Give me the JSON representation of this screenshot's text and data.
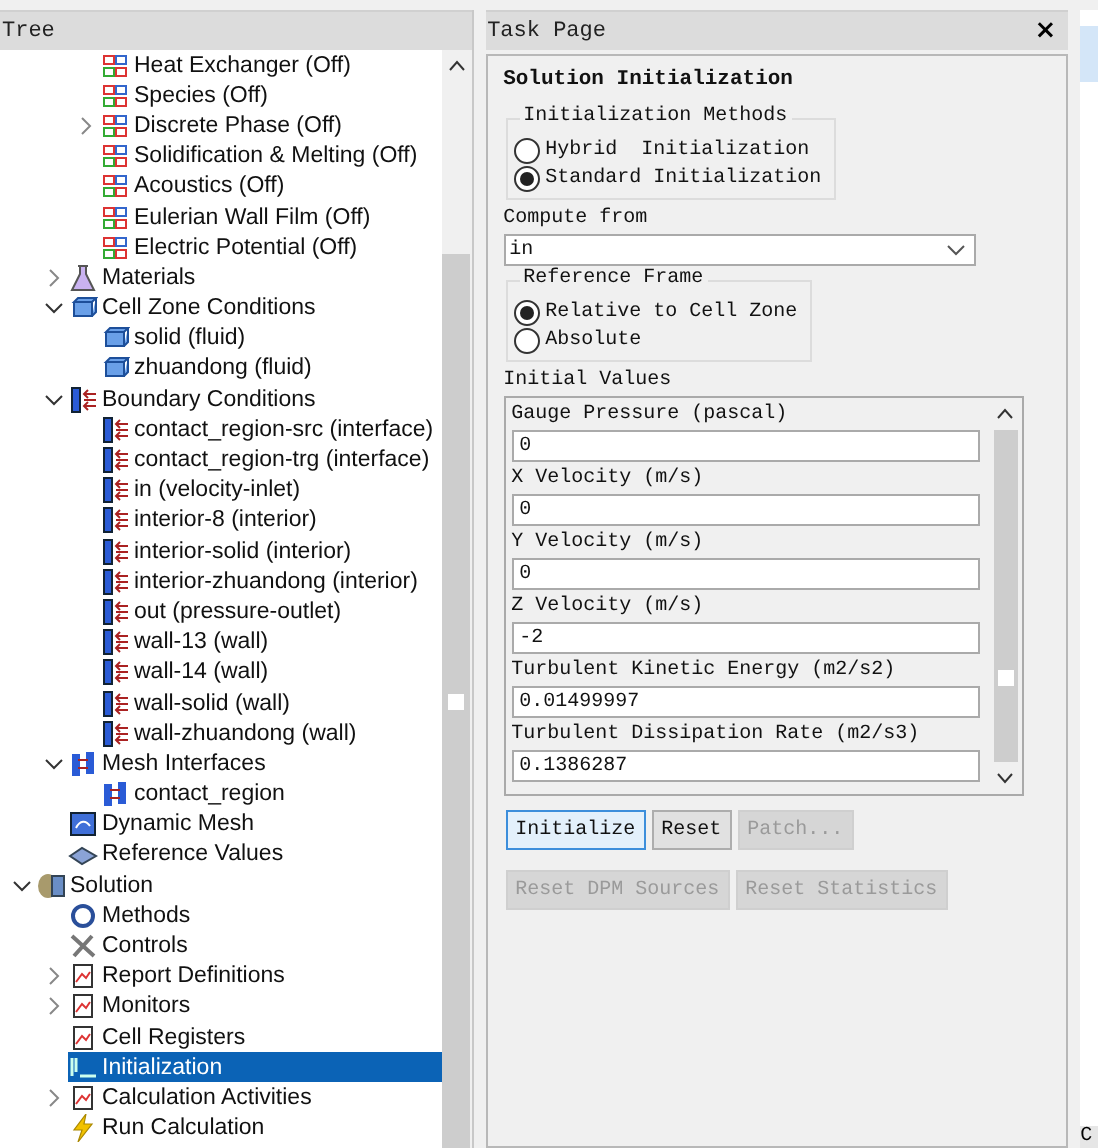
{
  "tree": {
    "title": "Tree",
    "items": [
      {
        "children": [
          {
            "children": [
              {
                "label": "Heat Exchanger (Off)",
                "kind": "model",
                "selected": false
              },
              {
                "label": "Species (Off)",
                "kind": "model",
                "selected": false
              },
              {
                "label": "Discrete Phase (Off)",
                "kind": "model",
                "expanded": false,
                "selected": false
              },
              {
                "label": "Solidification & Melting (Off)",
                "kind": "model",
                "selected": false
              },
              {
                "label": "Acoustics (Off)",
                "kind": "model",
                "selected": false
              },
              {
                "label": "Eulerian Wall Film (Off)",
                "kind": "model",
                "selected": false
              },
              {
                "label": "Electric Potential (Off)",
                "kind": "model",
                "selected": false
              }
            ]
          },
          {
            "label": "Materials",
            "kind": "flask",
            "expanded": false,
            "selected": false
          },
          {
            "label": "Cell Zone Conditions",
            "kind": "block",
            "expanded": true,
            "selected": false,
            "children": [
              {
                "label": "solid (fluid)",
                "kind": "block",
                "selected": false
              },
              {
                "label": "zhuandong (fluid)",
                "kind": "block",
                "selected": false
              }
            ]
          },
          {
            "label": "Boundary Conditions",
            "kind": "boundary",
            "expanded": true,
            "selected": false,
            "children": [
              {
                "label": "contact_region-src (interface)",
                "kind": "boundary",
                "selected": false
              },
              {
                "label": "contact_region-trg (interface)",
                "kind": "boundary",
                "selected": false
              },
              {
                "label": "in (velocity-inlet)",
                "kind": "boundary",
                "selected": false
              },
              {
                "label": "interior-8 (interior)",
                "kind": "boundary",
                "selected": false
              },
              {
                "label": "interior-solid (interior)",
                "kind": "boundary",
                "selected": false
              },
              {
                "label": "interior-zhuandong (interior)",
                "kind": "boundary",
                "selected": false
              },
              {
                "label": "out (pressure-outlet)",
                "kind": "boundary",
                "selected": false
              },
              {
                "label": "wall-13 (wall)",
                "kind": "boundary",
                "selected": false
              },
              {
                "label": "wall-14 (wall)",
                "kind": "boundary",
                "selected": false
              },
              {
                "label": "wall-solid (wall)",
                "kind": "boundary",
                "selected": false
              },
              {
                "label": "wall-zhuandong (wall)",
                "kind": "boundary",
                "selected": false
              }
            ]
          },
          {
            "label": "Mesh Interfaces",
            "kind": "interface",
            "expanded": true,
            "selected": false,
            "children": [
              {
                "label": "contact_region",
                "kind": "interface",
                "selected": false
              }
            ]
          },
          {
            "label": "Dynamic Mesh",
            "kind": "mesh",
            "selected": false
          },
          {
            "label": "Reference Values",
            "kind": "reference",
            "selected": false
          }
        ]
      },
      {
        "label": "Solution",
        "kind": "solution",
        "expanded": true,
        "selected": false,
        "children": [
          {
            "label": "Methods",
            "kind": "methods",
            "selected": false
          },
          {
            "label": "Controls",
            "kind": "tools",
            "selected": false
          },
          {
            "label": "Report Definitions",
            "kind": "report",
            "expanded": false,
            "selected": false
          },
          {
            "label": "Monitors",
            "kind": "report",
            "expanded": false,
            "selected": false
          },
          {
            "label": "Cell Registers",
            "kind": "report",
            "selected": false
          },
          {
            "label": "Initialization",
            "kind": "init",
            "selected": true
          },
          {
            "label": "Calculation Activities",
            "kind": "report",
            "expanded": false,
            "selected": false
          },
          {
            "label": "Run Calculation",
            "kind": "bolt",
            "selected": false
          }
        ]
      }
    ]
  },
  "task_page": {
    "title": "Task Page",
    "close": "×",
    "heading": "Solution Initialization",
    "methods": {
      "legend": "Initialization Methods",
      "options": [
        {
          "label": "Hybrid  Initialization",
          "selected": false
        },
        {
          "label": "Standard Initialization",
          "selected": true
        }
      ]
    },
    "compute_from": {
      "label": "Compute from",
      "value": "in"
    },
    "reference_frame": {
      "legend": "Reference Frame",
      "options": [
        {
          "label": "Relative to Cell Zone",
          "selected": true
        },
        {
          "label": "Absolute",
          "selected": false
        }
      ]
    },
    "initial_values": {
      "label": "Initial Values",
      "fields": [
        {
          "label": "Gauge Pressure (pascal)",
          "value": "0"
        },
        {
          "label": "X Velocity (m/s)",
          "value": "0"
        },
        {
          "label": "Y Velocity (m/s)",
          "value": "0"
        },
        {
          "label": "Z Velocity (m/s)",
          "value": "-2"
        },
        {
          "label": "Turbulent Kinetic Energy (m2/s2)",
          "value": "0.01499997"
        },
        {
          "label": "Turbulent Dissipation Rate (m2/s3)",
          "value": "0.1386287"
        }
      ]
    },
    "button_rows": [
      [
        {
          "label": "Initialize",
          "disabled": false,
          "focused": true
        },
        {
          "label": "Reset",
          "disabled": false,
          "focused": false
        },
        {
          "label": "Patch...",
          "disabled": true,
          "focused": false
        }
      ],
      [
        {
          "label": "Reset DPM Sources",
          "disabled": true,
          "focused": false
        },
        {
          "label": "Reset Statistics",
          "disabled": true,
          "focused": false
        }
      ]
    ]
  },
  "side_panel": {
    "text": "C"
  }
}
